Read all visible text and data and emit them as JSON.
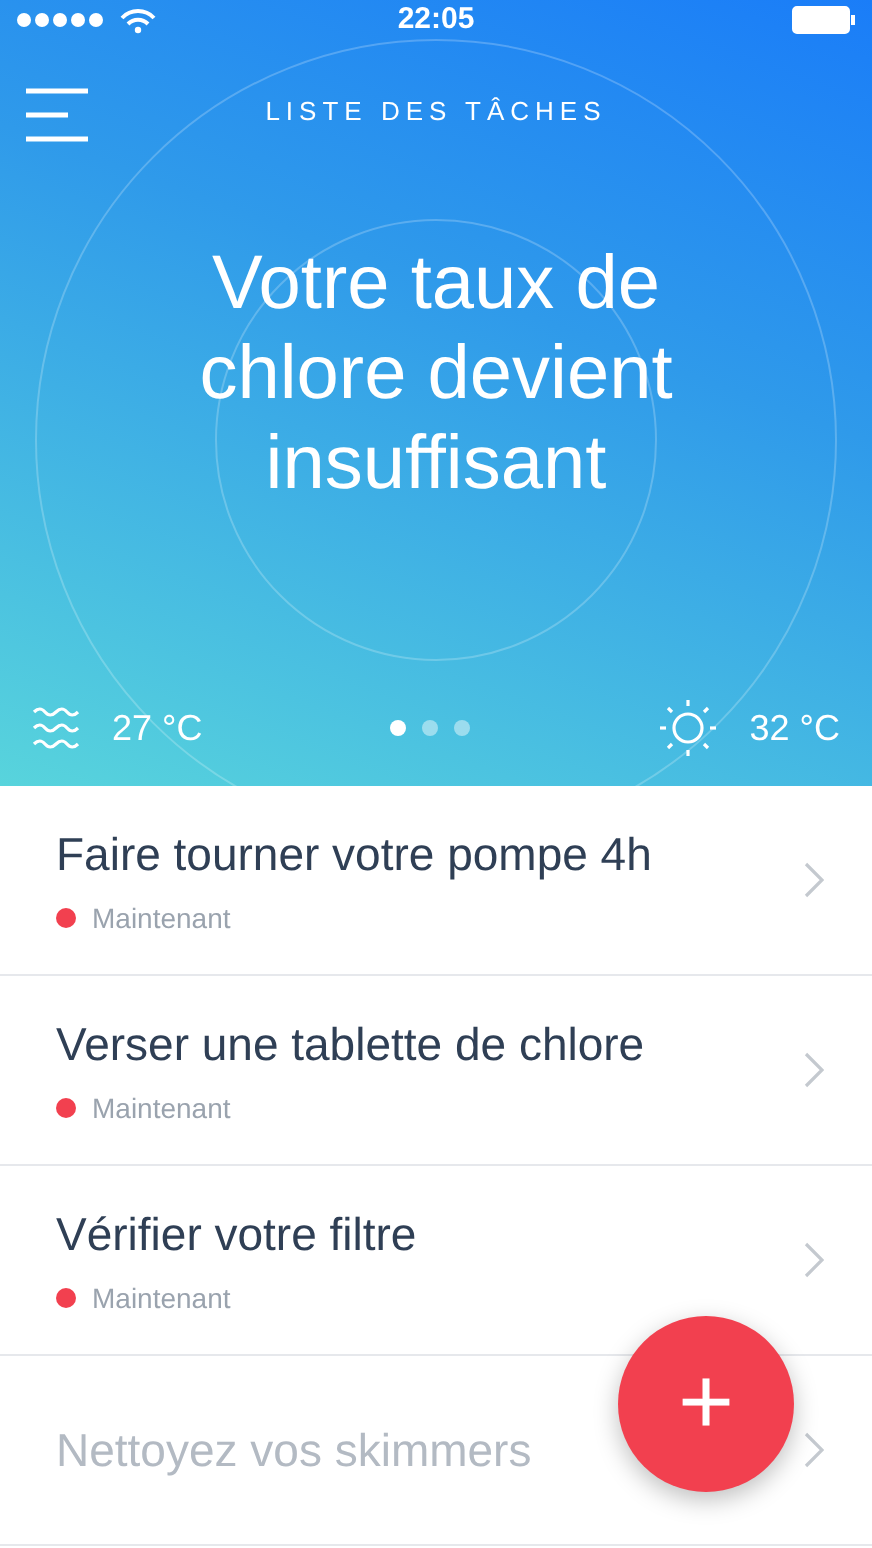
{
  "status_bar": {
    "time": "22:05"
  },
  "header": {
    "title": "LISTE DES TÂCHES",
    "headline": "Votre taux de chlore devient insuffisant",
    "water_temp": "27 °C",
    "air_temp": "32 °C",
    "pages": [
      {
        "selected": true
      },
      {
        "selected": false
      },
      {
        "selected": false
      }
    ]
  },
  "tasks": [
    {
      "title": "Faire tourner votre pompe 4h",
      "status": "Maintenant",
      "disabled": false
    },
    {
      "title": "Verser une tablette de chlore",
      "status": "Maintenant",
      "disabled": false
    },
    {
      "title": "Vérifier votre filtre",
      "status": "Maintenant",
      "disabled": false
    },
    {
      "title": "Nettoyez vos skimmers",
      "disabled": true
    }
  ],
  "fab": {
    "label": "+"
  }
}
